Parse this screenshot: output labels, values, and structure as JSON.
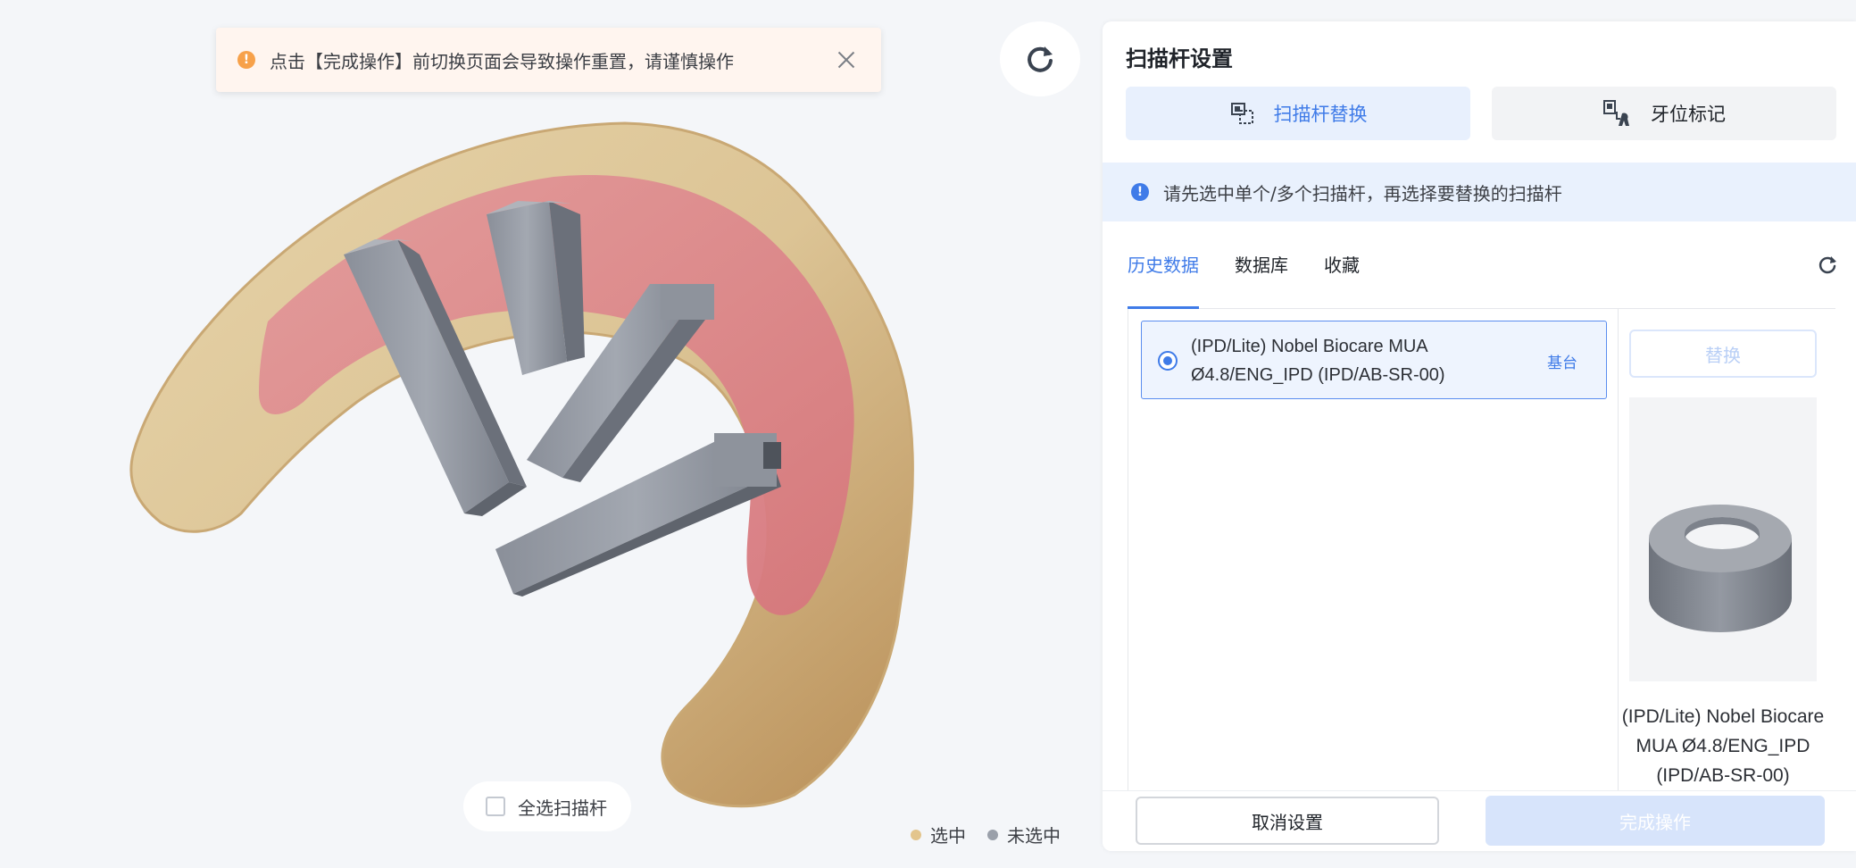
{
  "toast": {
    "message": "点击【完成操作】前切换页面会导致操作重置，请谨慎操作"
  },
  "viewport": {
    "select_all_label": "全选扫描杆",
    "legend": [
      {
        "label": "选中",
        "color": "#e3c58d"
      },
      {
        "label": "未选中",
        "color": "#9aa0aa"
      }
    ]
  },
  "panel": {
    "title": "扫描杆设置",
    "mode_tabs": [
      {
        "label": "扫描杆替换",
        "active": true
      },
      {
        "label": "牙位标记",
        "active": false
      }
    ],
    "info": "请先选中单个/多个扫描杆，再选择要替换的扫描杆",
    "sub_tabs": [
      {
        "label": "历史数据",
        "active": true
      },
      {
        "label": "数据库",
        "active": false
      },
      {
        "label": "收藏",
        "active": false
      }
    ],
    "list": [
      {
        "name": "(IPD/Lite) Nobel Biocare MUA Ø4.8/ENG_IPD (IPD/AB-SR-00)",
        "tag": "基台",
        "selected": true
      }
    ],
    "replace_label": "替换",
    "preview_name": "(IPD/Lite) Nobel Biocare MUA Ø4.8/ENG_IPD (IPD/AB-SR-00)",
    "cancel_label": "取消设置",
    "finish_label": "完成操作"
  },
  "colors": {
    "accent": "#3f7be8",
    "warning": "#f7a14a",
    "toast_bg": "#fff5ef",
    "info_bg": "#e9f1fd"
  }
}
